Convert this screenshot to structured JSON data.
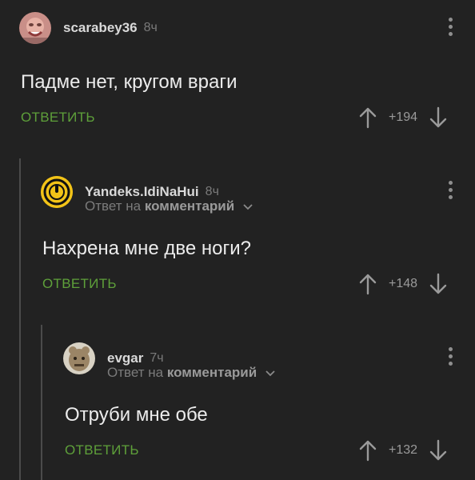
{
  "comments": [
    {
      "username": "scarabey36",
      "time": "8ч",
      "text": "Падме нет, кругом враги",
      "reply_label": "ОТВЕТИТЬ",
      "rating": "+194"
    },
    {
      "username": "Yandeks.IdiNaHui",
      "time": "8ч",
      "reply_to_prefix": "Ответ на",
      "reply_to_link": "комментарий",
      "text": "Нахрена мне две ноги?",
      "reply_label": "ОТВЕТИТЬ",
      "rating": "+148"
    },
    {
      "username": "evgar",
      "time": "7ч",
      "reply_to_prefix": "Ответ на",
      "reply_to_link": "комментарий",
      "text": "Отруби мне обе",
      "reply_label": "ОТВЕТИТЬ",
      "rating": "+132"
    }
  ],
  "colors": {
    "background": "#222222",
    "reply": "#5ea03a",
    "thread_line": "#4b4b4b"
  }
}
